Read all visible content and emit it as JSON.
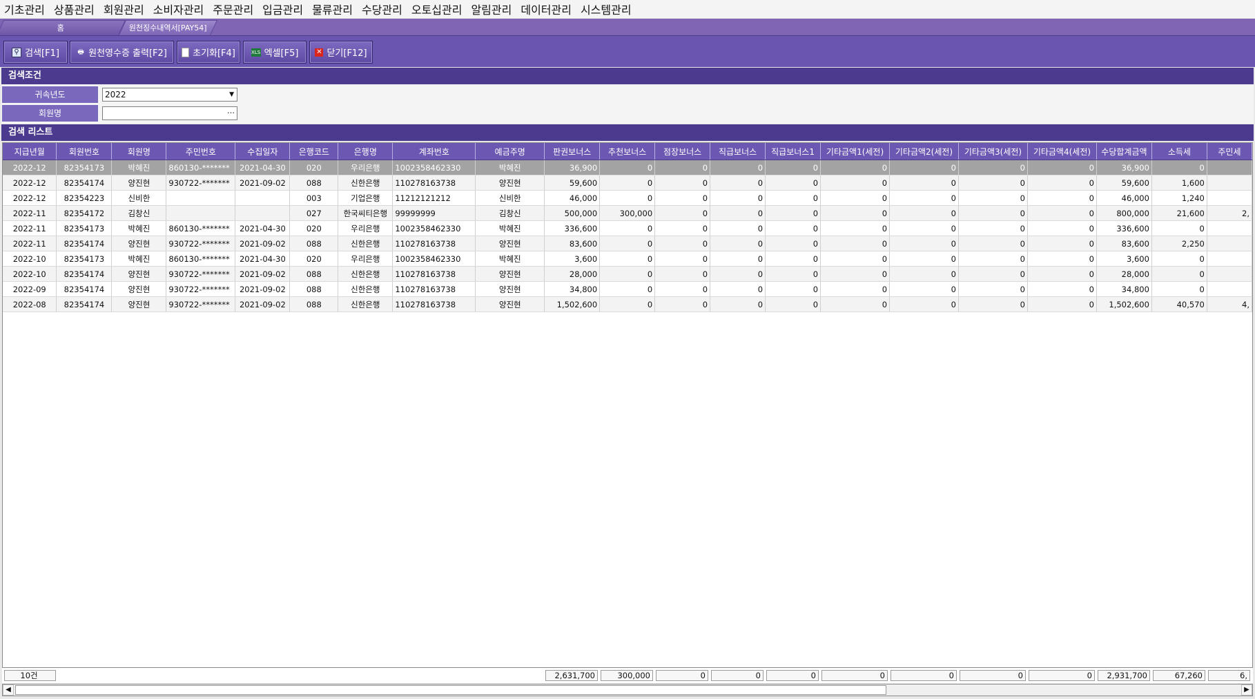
{
  "menu": [
    "기초관리",
    "상품관리",
    "회원관리",
    "소비자관리",
    "주문관리",
    "입금관리",
    "물류관리",
    "수당관리",
    "오토십관리",
    "알림관리",
    "데이터관리",
    "시스템관리"
  ],
  "tabs": [
    {
      "label": "홈"
    },
    {
      "label": "원천징수내역서[PAY54]"
    }
  ],
  "toolbar": {
    "search": "검색[F1]",
    "print_receipt": "원천영수증 출력[F2]",
    "reset": "초기화[F4]",
    "excel": "엑셀[F5]",
    "close": "닫기[F12]"
  },
  "search_section": {
    "title": "검색조건",
    "year_label": "귀속년도",
    "year_value": "2022",
    "member_label": "회원명",
    "member_value": ""
  },
  "list_section": {
    "title": "검색 리스트"
  },
  "columns": [
    "지급년월",
    "회원번호",
    "회원명",
    "주민번호",
    "수집일자",
    "은행코드",
    "은행명",
    "계좌번호",
    "예금주명",
    "판권보너스",
    "추천보너스",
    "점장보너스",
    "직급보너스",
    "직급보너스1",
    "기타금액1(세전)",
    "기타금액2(세전)",
    "기타금액3(세전)",
    "기타금액4(세전)",
    "수당합계금액",
    "소득세",
    "주민세"
  ],
  "rows": [
    [
      "2022-12",
      "82354173",
      "박혜진",
      "860130-*******",
      "2021-04-30",
      "020",
      "우리은행",
      "1002358462330",
      "박혜진",
      "36,900",
      "0",
      "0",
      "0",
      "0",
      "0",
      "0",
      "0",
      "0",
      "36,900",
      "0",
      ""
    ],
    [
      "2022-12",
      "82354174",
      "양진현",
      "930722-*******",
      "2021-09-02",
      "088",
      "신한은행",
      "110278163738",
      "양진현",
      "59,600",
      "0",
      "0",
      "0",
      "0",
      "0",
      "0",
      "0",
      "0",
      "59,600",
      "1,600",
      ""
    ],
    [
      "2022-12",
      "82354223",
      "신비한",
      "",
      "",
      "003",
      "기업은행",
      "11212121212",
      "신비한",
      "46,000",
      "0",
      "0",
      "0",
      "0",
      "0",
      "0",
      "0",
      "0",
      "46,000",
      "1,240",
      ""
    ],
    [
      "2022-11",
      "82354172",
      "김창신",
      "",
      "",
      "027",
      "한국씨티은행",
      "99999999",
      "김창신",
      "500,000",
      "300,000",
      "0",
      "0",
      "0",
      "0",
      "0",
      "0",
      "0",
      "800,000",
      "21,600",
      "2,"
    ],
    [
      "2022-11",
      "82354173",
      "박혜진",
      "860130-*******",
      "2021-04-30",
      "020",
      "우리은행",
      "1002358462330",
      "박혜진",
      "336,600",
      "0",
      "0",
      "0",
      "0",
      "0",
      "0",
      "0",
      "0",
      "336,600",
      "0",
      ""
    ],
    [
      "2022-11",
      "82354174",
      "양진현",
      "930722-*******",
      "2021-09-02",
      "088",
      "신한은행",
      "110278163738",
      "양진현",
      "83,600",
      "0",
      "0",
      "0",
      "0",
      "0",
      "0",
      "0",
      "0",
      "83,600",
      "2,250",
      ""
    ],
    [
      "2022-10",
      "82354173",
      "박혜진",
      "860130-*******",
      "2021-04-30",
      "020",
      "우리은행",
      "1002358462330",
      "박혜진",
      "3,600",
      "0",
      "0",
      "0",
      "0",
      "0",
      "0",
      "0",
      "0",
      "3,600",
      "0",
      ""
    ],
    [
      "2022-10",
      "82354174",
      "양진현",
      "930722-*******",
      "2021-09-02",
      "088",
      "신한은행",
      "110278163738",
      "양진현",
      "28,000",
      "0",
      "0",
      "0",
      "0",
      "0",
      "0",
      "0",
      "0",
      "28,000",
      "0",
      ""
    ],
    [
      "2022-09",
      "82354174",
      "양진현",
      "930722-*******",
      "2021-09-02",
      "088",
      "신한은행",
      "110278163738",
      "양진현",
      "34,800",
      "0",
      "0",
      "0",
      "0",
      "0",
      "0",
      "0",
      "0",
      "34,800",
      "0",
      ""
    ],
    [
      "2022-08",
      "82354174",
      "양진현",
      "930722-*******",
      "2021-09-02",
      "088",
      "신한은행",
      "110278163738",
      "양진현",
      "1,502,600",
      "0",
      "0",
      "0",
      "0",
      "0",
      "0",
      "0",
      "0",
      "1,502,600",
      "40,570",
      "4,"
    ]
  ],
  "footer": {
    "count": "10건",
    "totals": [
      "2,631,700",
      "300,000",
      "0",
      "0",
      "0",
      "0",
      "0",
      "0",
      "0",
      "2,931,700",
      "67,260",
      "6,"
    ]
  }
}
